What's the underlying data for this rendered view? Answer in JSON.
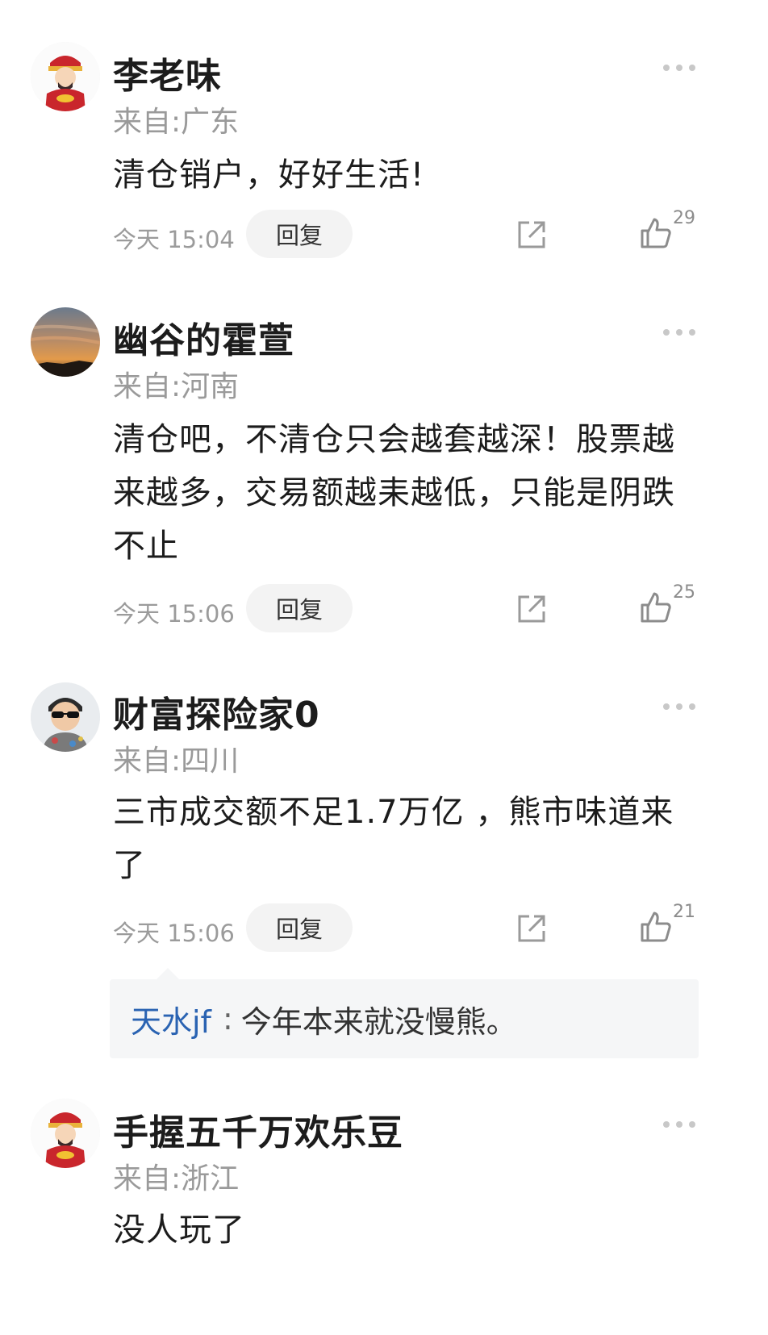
{
  "comments": [
    {
      "user": "李老味",
      "location": "来自:广东",
      "text": "清仓销户，好好生活!",
      "time": "今天 15:04",
      "reply_label": "回复",
      "likes": "29",
      "avatar_icon": "god-of-wealth-avatar"
    },
    {
      "user": "幽谷的霍萱",
      "location": "来自:河南",
      "text": "清仓吧，不清仓只会越套越深！股票越来越多，交易额越耒越低，只能是阴跌不止",
      "time": "今天 15:06",
      "reply_label": "回复",
      "likes": "25",
      "avatar_icon": "sunset-avatar"
    },
    {
      "user": "财富探险家0",
      "location": "来自:四川",
      "text": "三市成交额不足1.7万亿 ，熊市味道来了",
      "time": "今天 15:06",
      "reply_label": "回复",
      "likes": "21",
      "avatar_icon": "kid-sunglasses-avatar",
      "sub_reply": {
        "user": "天水jf",
        "separator": ":",
        "text": "今年本来就没慢熊。"
      }
    },
    {
      "user": "手握五千万欢乐豆",
      "location": "来自:浙江",
      "text": "没人玩了",
      "avatar_icon": "god-of-wealth-avatar"
    }
  ],
  "colors": {
    "name": "#1c1c1c",
    "meta": "#9a9a9a",
    "link": "#2a63b2",
    "reply_bg": "#f3f3f3"
  }
}
